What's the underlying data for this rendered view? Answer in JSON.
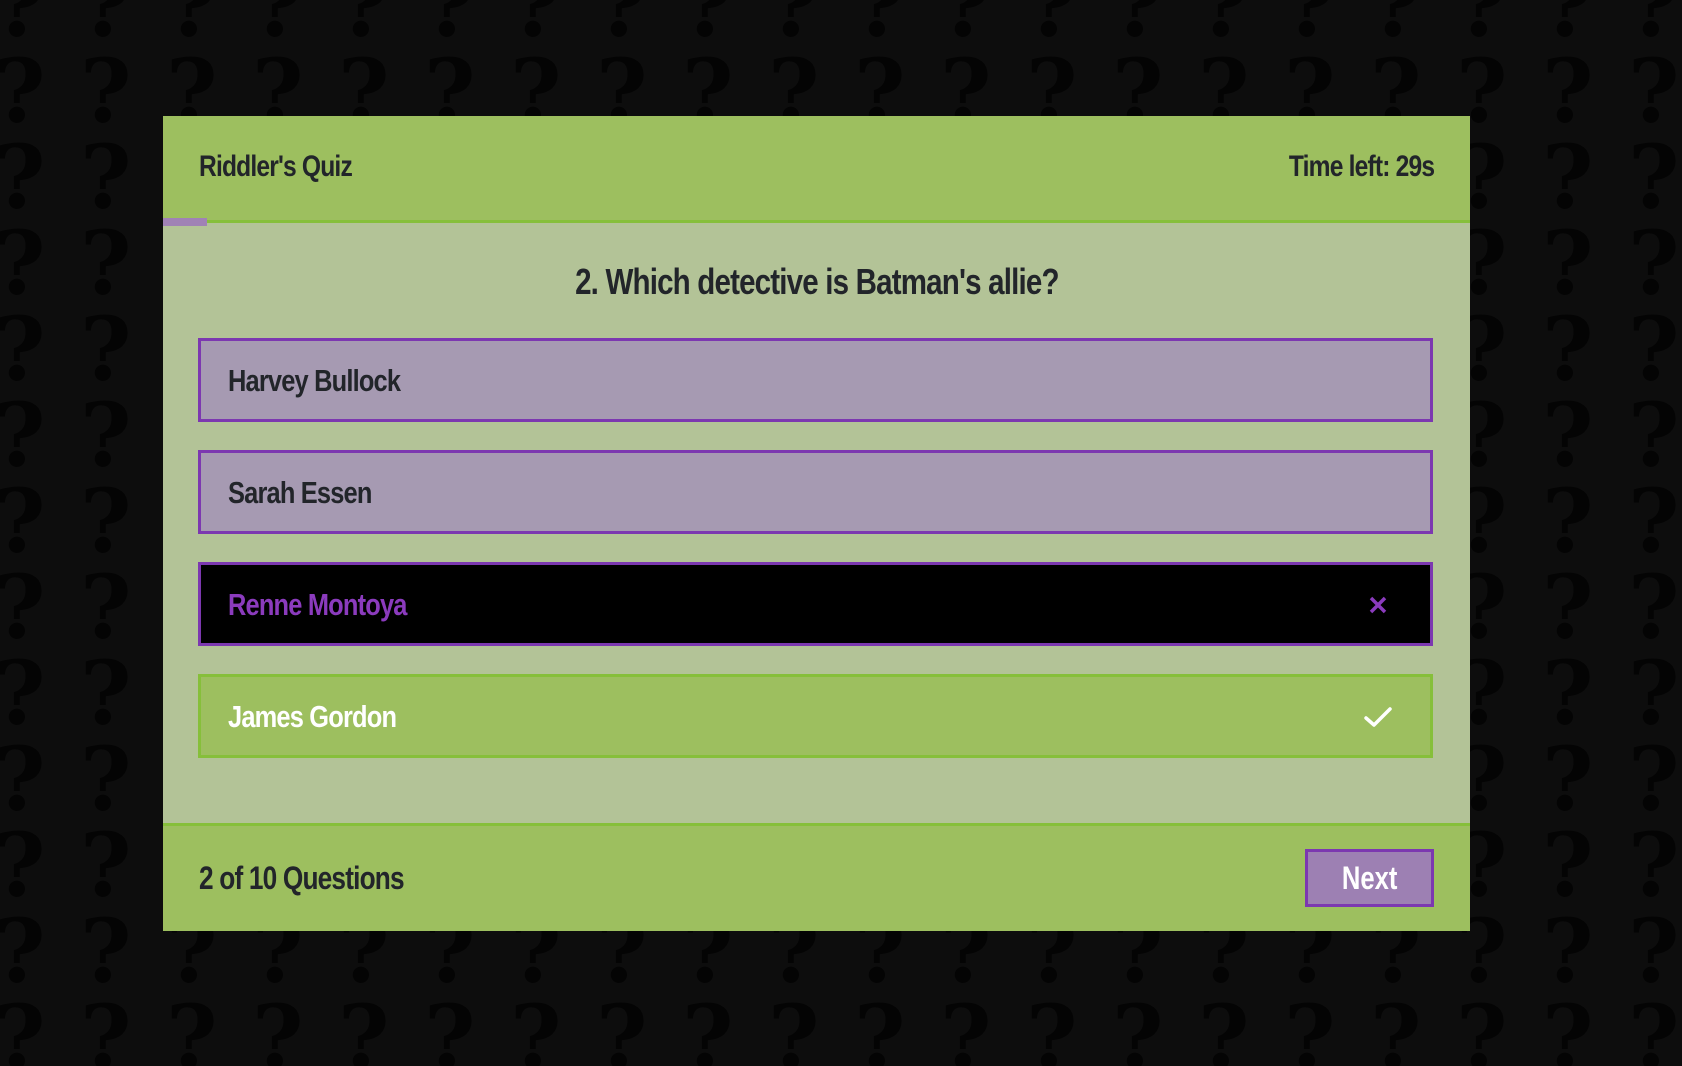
{
  "header": {
    "title": "Riddler's Quiz",
    "timer": "Time left: 29s"
  },
  "progress": {
    "current": 2,
    "total": 10
  },
  "question": {
    "text": "2. Which detective is Batman's allie?"
  },
  "options": [
    {
      "label": "Harvey Bullock",
      "state": "neutral"
    },
    {
      "label": "Sarah Essen",
      "state": "neutral"
    },
    {
      "label": "Renne Montoya",
      "state": "wrong",
      "icon": "close-icon"
    },
    {
      "label": "James Gordon",
      "state": "correct",
      "icon": "check-icon"
    }
  ],
  "footer": {
    "count": "2 of 10 Questions",
    "next_label": "Next"
  },
  "colors": {
    "accent_green": "#9dbf5f",
    "accent_purple": "#7c38b0",
    "body": "#b3c397"
  }
}
